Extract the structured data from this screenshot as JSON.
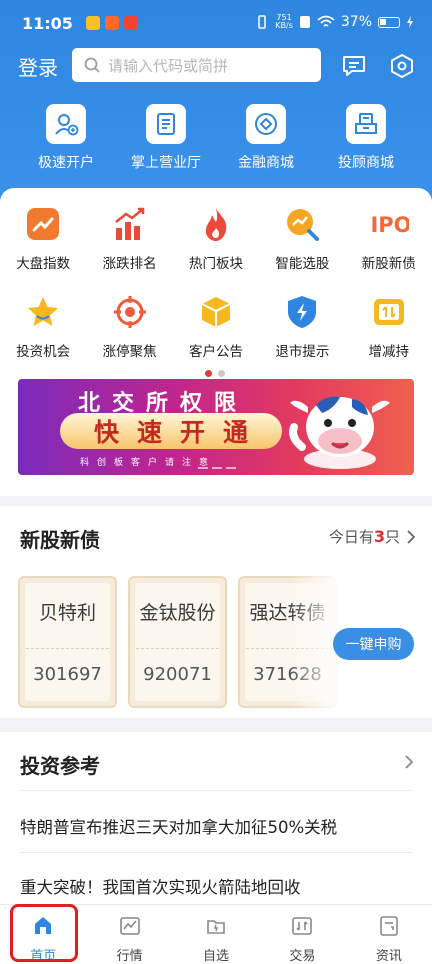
{
  "status": {
    "time": "11:05",
    "speed_top": "751",
    "speed_bottom": "KB/s",
    "battery": "37%"
  },
  "header": {
    "login": "登录",
    "search_placeholder": "请输入代码或简拼",
    "quick_items": [
      {
        "label": "极速开户",
        "icon": "open-account-icon"
      },
      {
        "label": "掌上营业厅",
        "icon": "mobile-hall-icon"
      },
      {
        "label": "金融商城",
        "icon": "finance-mall-icon"
      },
      {
        "label": "投顾商城",
        "icon": "advisor-mall-icon"
      }
    ]
  },
  "grid": [
    {
      "label": "大盘指数",
      "icon": "trend-icon",
      "color": "#f07a2e"
    },
    {
      "label": "涨跌排名",
      "icon": "bar-rank-icon",
      "color": "#e84a3a"
    },
    {
      "label": "热门板块",
      "icon": "flame-icon",
      "color": "#ee4a3c"
    },
    {
      "label": "智能选股",
      "icon": "smart-pick-icon",
      "color": "#f5a623"
    },
    {
      "label": "新股新债",
      "icon": "ipo-icon",
      "color": "#f26a3a"
    },
    {
      "label": "投资机会",
      "icon": "star-icon",
      "color": "#f5b81f"
    },
    {
      "label": "涨停聚焦",
      "icon": "target-icon",
      "color": "#ee5a3a"
    },
    {
      "label": "客户公告",
      "icon": "cube-icon",
      "color": "#f5b81f"
    },
    {
      "label": "退市提示",
      "icon": "shield-icon",
      "color": "#2f86e0"
    },
    {
      "label": "增减持",
      "icon": "increase-icon",
      "color": "#f5b81f"
    }
  ],
  "banner": {
    "top": "北交所权限",
    "pill": "快速开通",
    "sub": "科创板客户请注意"
  },
  "ipo": {
    "title": "新股新债",
    "today_prefix": "今日有",
    "today_count": "3",
    "today_suffix": "只",
    "tickets": [
      {
        "name": "贝特利",
        "code": "301697"
      },
      {
        "name": "金钛股份",
        "code": "920071"
      },
      {
        "name": "强达转债",
        "code": "371628"
      }
    ],
    "buy_button": "一键申购"
  },
  "reference": {
    "title": "投资参考",
    "news": [
      "特朗普宣布推迟三天对加拿大加征50%关税",
      "重大突破！我国首次实现火箭陆地回收"
    ]
  },
  "tabs": [
    {
      "label": "首页",
      "icon": "home-icon"
    },
    {
      "label": "行情",
      "icon": "market-icon"
    },
    {
      "label": "自选",
      "icon": "watchlist-icon"
    },
    {
      "label": "交易",
      "icon": "trade-icon"
    },
    {
      "label": "资讯",
      "icon": "news-icon"
    }
  ]
}
